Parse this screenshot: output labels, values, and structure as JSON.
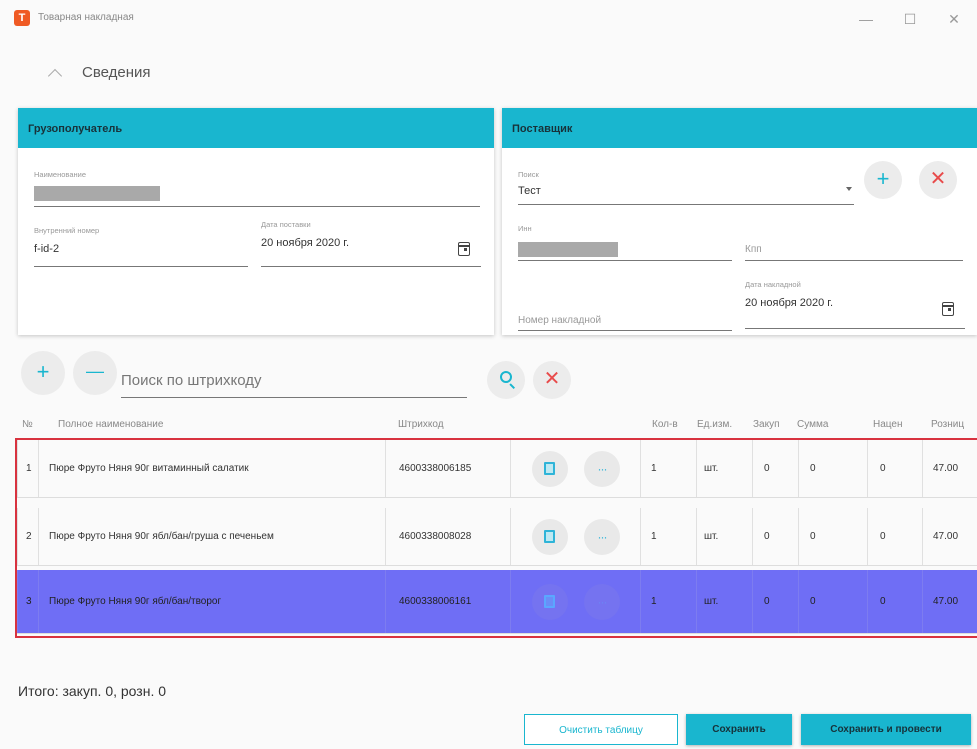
{
  "window": {
    "title": "Товарная накладная",
    "app_icon_letter": "Т",
    "minimize": "—",
    "maximize": "☐",
    "close": "✕"
  },
  "section": {
    "title": "Сведения"
  },
  "consignee": {
    "header": "Грузополучатель",
    "name_label": "Наименование",
    "internal_number_label": "Внутренний номер",
    "internal_number_value": "f-id-2",
    "delivery_date_label": "Дата поставки",
    "delivery_date_value": "20 ноября 2020 г."
  },
  "supplier": {
    "header": "Поставщик",
    "search_label": "Поиск",
    "search_value": "Тест",
    "inn_label": "Инн",
    "kpp_placeholder": "Кпп",
    "invoice_number_placeholder": "Номер накладной",
    "invoice_date_label": "Дата накладной",
    "invoice_date_value": "20 ноября 2020 г.",
    "add_symbol": "+",
    "clear_symbol": "✕"
  },
  "toolbar": {
    "add_symbol": "+",
    "remove_symbol": "—",
    "barcode_search_placeholder": "Поиск по штрихкоду",
    "clear_symbol": "✕"
  },
  "table": {
    "columns": [
      "№",
      "Полное наименование",
      "Штрихкод",
      "Кол-в",
      "Ед.изм.",
      "Закуп",
      "Сумма",
      "Нацен",
      "Розниц"
    ],
    "rows": [
      {
        "num": "1",
        "name": "Пюре Фруто Няня 90г витаминный салатик",
        "barcode": "4600338006185",
        "qty": "1",
        "unit": "шт.",
        "purchase": "0",
        "sum": "0",
        "markup": "0",
        "retail": "47.00",
        "menu": "···"
      },
      {
        "num": "2",
        "name": "Пюре Фруто Няня 90г ябл/бан/груша с печеньем",
        "barcode": "4600338008028",
        "qty": "1",
        "unit": "шт.",
        "purchase": "0",
        "sum": "0",
        "markup": "0",
        "retail": "47.00",
        "menu": "···"
      },
      {
        "num": "3",
        "name": "Пюре Фруто Няня 90г ябл/бан/творог",
        "barcode": "4600338006161",
        "qty": "1",
        "unit": "шт.",
        "purchase": "0",
        "sum": "0",
        "markup": "0",
        "retail": "47.00",
        "menu": "···"
      }
    ],
    "selected_row": 3
  },
  "footer": {
    "total": "Итого: закуп. 0, розн. 0",
    "clear_table": "Очистить таблицу",
    "save": "Сохранить",
    "save_and_post": "Сохранить и провести"
  },
  "colors": {
    "accent": "#19b6cf",
    "danger": "#e84b4b",
    "selected_row": "#6f6ef5",
    "highlight_border": "#d8323f"
  }
}
